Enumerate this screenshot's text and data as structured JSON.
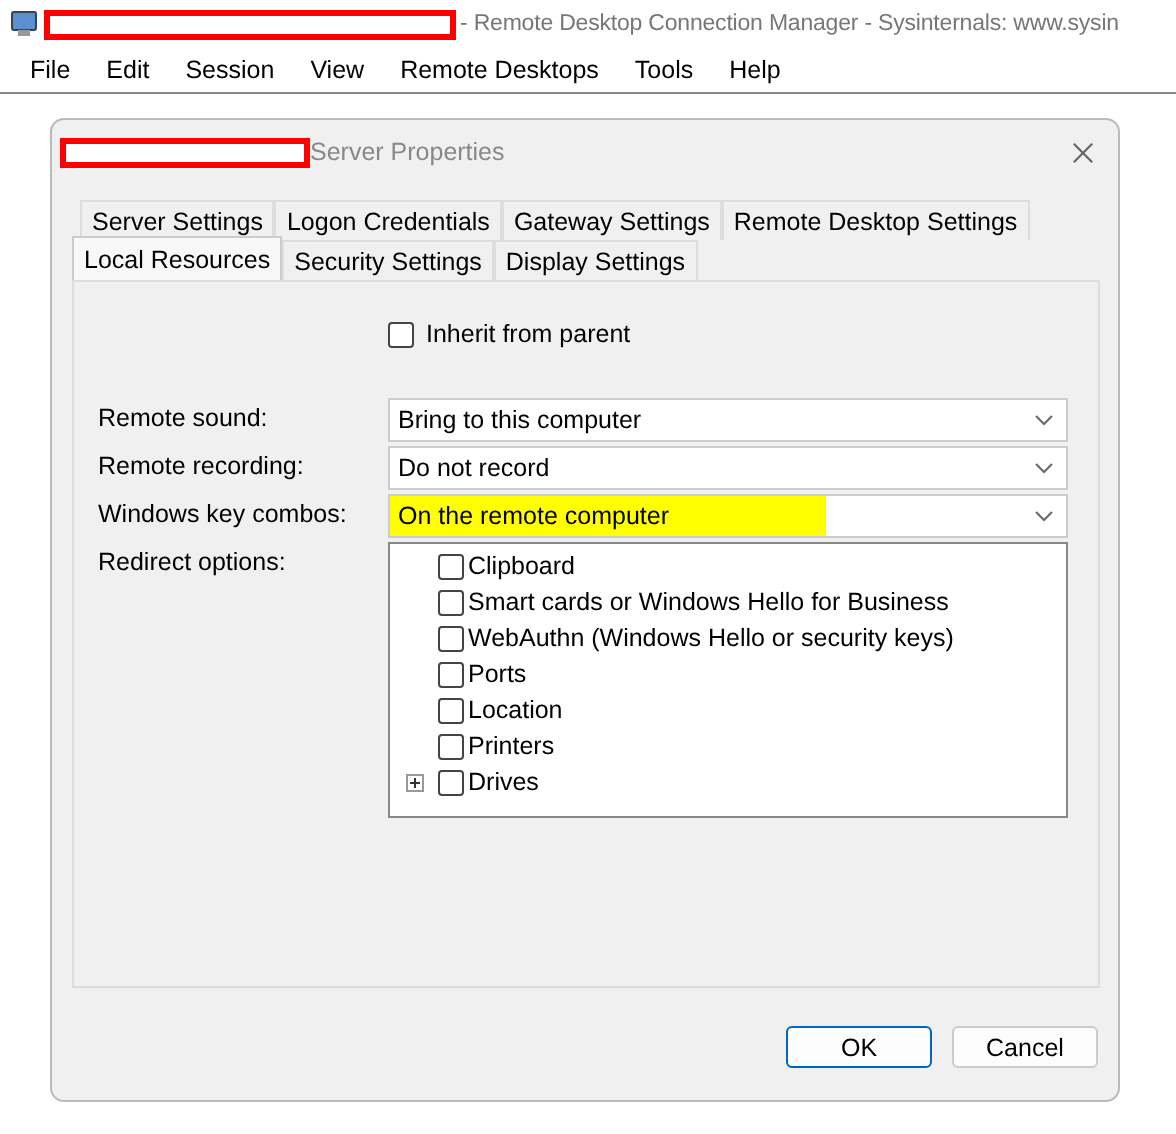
{
  "window": {
    "title": "- Remote Desktop Connection Manager - Sysinternals: www.sysin"
  },
  "menu": [
    "File",
    "Edit",
    "Session",
    "View",
    "Remote Desktops",
    "Tools",
    "Help"
  ],
  "dialog": {
    "title": "Server Properties",
    "tab_rows": [
      [
        {
          "label": "Server Settings",
          "selected": false
        },
        {
          "label": "Logon Credentials",
          "selected": false
        },
        {
          "label": "Gateway Settings",
          "selected": false
        },
        {
          "label": "Remote Desktop Settings",
          "selected": false
        }
      ],
      [
        {
          "label": "Local Resources",
          "selected": true
        },
        {
          "label": "Security Settings",
          "selected": false
        },
        {
          "label": "Display Settings",
          "selected": false
        }
      ]
    ],
    "inherit": {
      "label": "Inherit from parent",
      "checked": false
    },
    "fields": [
      {
        "label": "Remote sound:",
        "value": "Bring to this computer",
        "highlighted": false
      },
      {
        "label": "Remote recording:",
        "value": "Do not record",
        "highlighted": false
      },
      {
        "label": "Windows key combos:",
        "value": "On the remote computer",
        "highlighted": true
      }
    ],
    "redirect": {
      "label": "Redirect options:",
      "items": [
        {
          "label": "Clipboard",
          "checked": false,
          "expandable": false
        },
        {
          "label": "Smart cards or Windows Hello for Business",
          "checked": false,
          "expandable": false
        },
        {
          "label": "WebAuthn (Windows Hello or security keys)",
          "checked": false,
          "expandable": false
        },
        {
          "label": "Ports",
          "checked": false,
          "expandable": false
        },
        {
          "label": "Location",
          "checked": false,
          "expandable": false
        },
        {
          "label": "Printers",
          "checked": false,
          "expandable": false
        },
        {
          "label": "Drives",
          "checked": false,
          "expandable": true
        }
      ]
    },
    "buttons": [
      "OK",
      "Cancel"
    ]
  }
}
